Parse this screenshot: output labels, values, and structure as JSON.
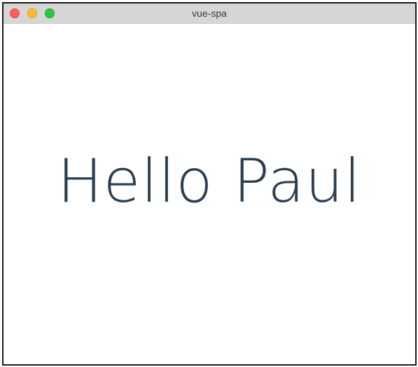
{
  "window": {
    "title": "vue-spa"
  },
  "app": {
    "greeting": "Hello Paul"
  },
  "colors": {
    "text": "#2c3e50",
    "titlebar": "#d6d6d6",
    "close": "#ff5f57",
    "minimize": "#febc2e",
    "zoom": "#28c840"
  }
}
